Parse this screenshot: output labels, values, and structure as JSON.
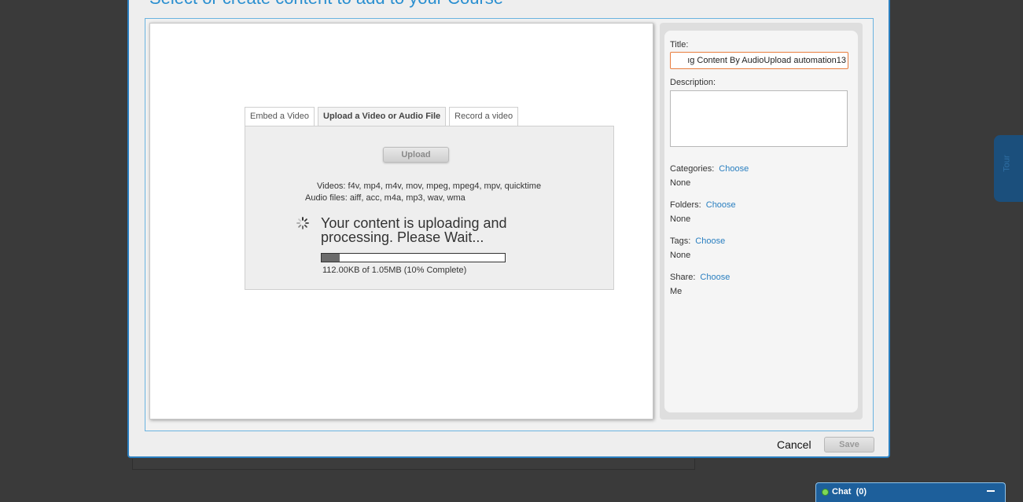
{
  "modal": {
    "title": "Select or create content to add to your Course"
  },
  "tabs": [
    {
      "label": "Embed a Video"
    },
    {
      "label": "Upload a Video or Audio File"
    },
    {
      "label": "Record a video"
    }
  ],
  "upload": {
    "button_label": "Upload",
    "video_formats": "Videos: f4v, mp4, m4v, mov, mpeg, mpeg4, mpv, quicktime",
    "audio_formats": "Audio files: aiff, acc, m4a, mp3, wav, wma",
    "status_message": "Your content is uploading and processing. Please Wait...",
    "progress_fraction": 0.1,
    "progress_text": "112.00KB of 1.05MB (10% Complete)"
  },
  "details": {
    "title_label": "Title:",
    "title_value": "ıg Content By AudioUpload automation13",
    "description_label": "Description:",
    "description_value": "",
    "categories_label": "Categories:",
    "categories_value": "None",
    "folders_label": "Folders:",
    "folders_value": "None",
    "tags_label": "Tags:",
    "tags_value": "None",
    "share_label": "Share:",
    "share_value": "Me",
    "choose_label": "Choose"
  },
  "footer": {
    "cancel_label": "Cancel",
    "save_label": "Save"
  },
  "side_tab": {
    "label": "Tour"
  },
  "chat": {
    "label": "Chat",
    "count": "(0)"
  },
  "colors": {
    "accent": "#2a7fc0",
    "input_focus": "#e87d3e",
    "chat_bar": "#1d5f9b",
    "online_dot": "#7ed957"
  }
}
